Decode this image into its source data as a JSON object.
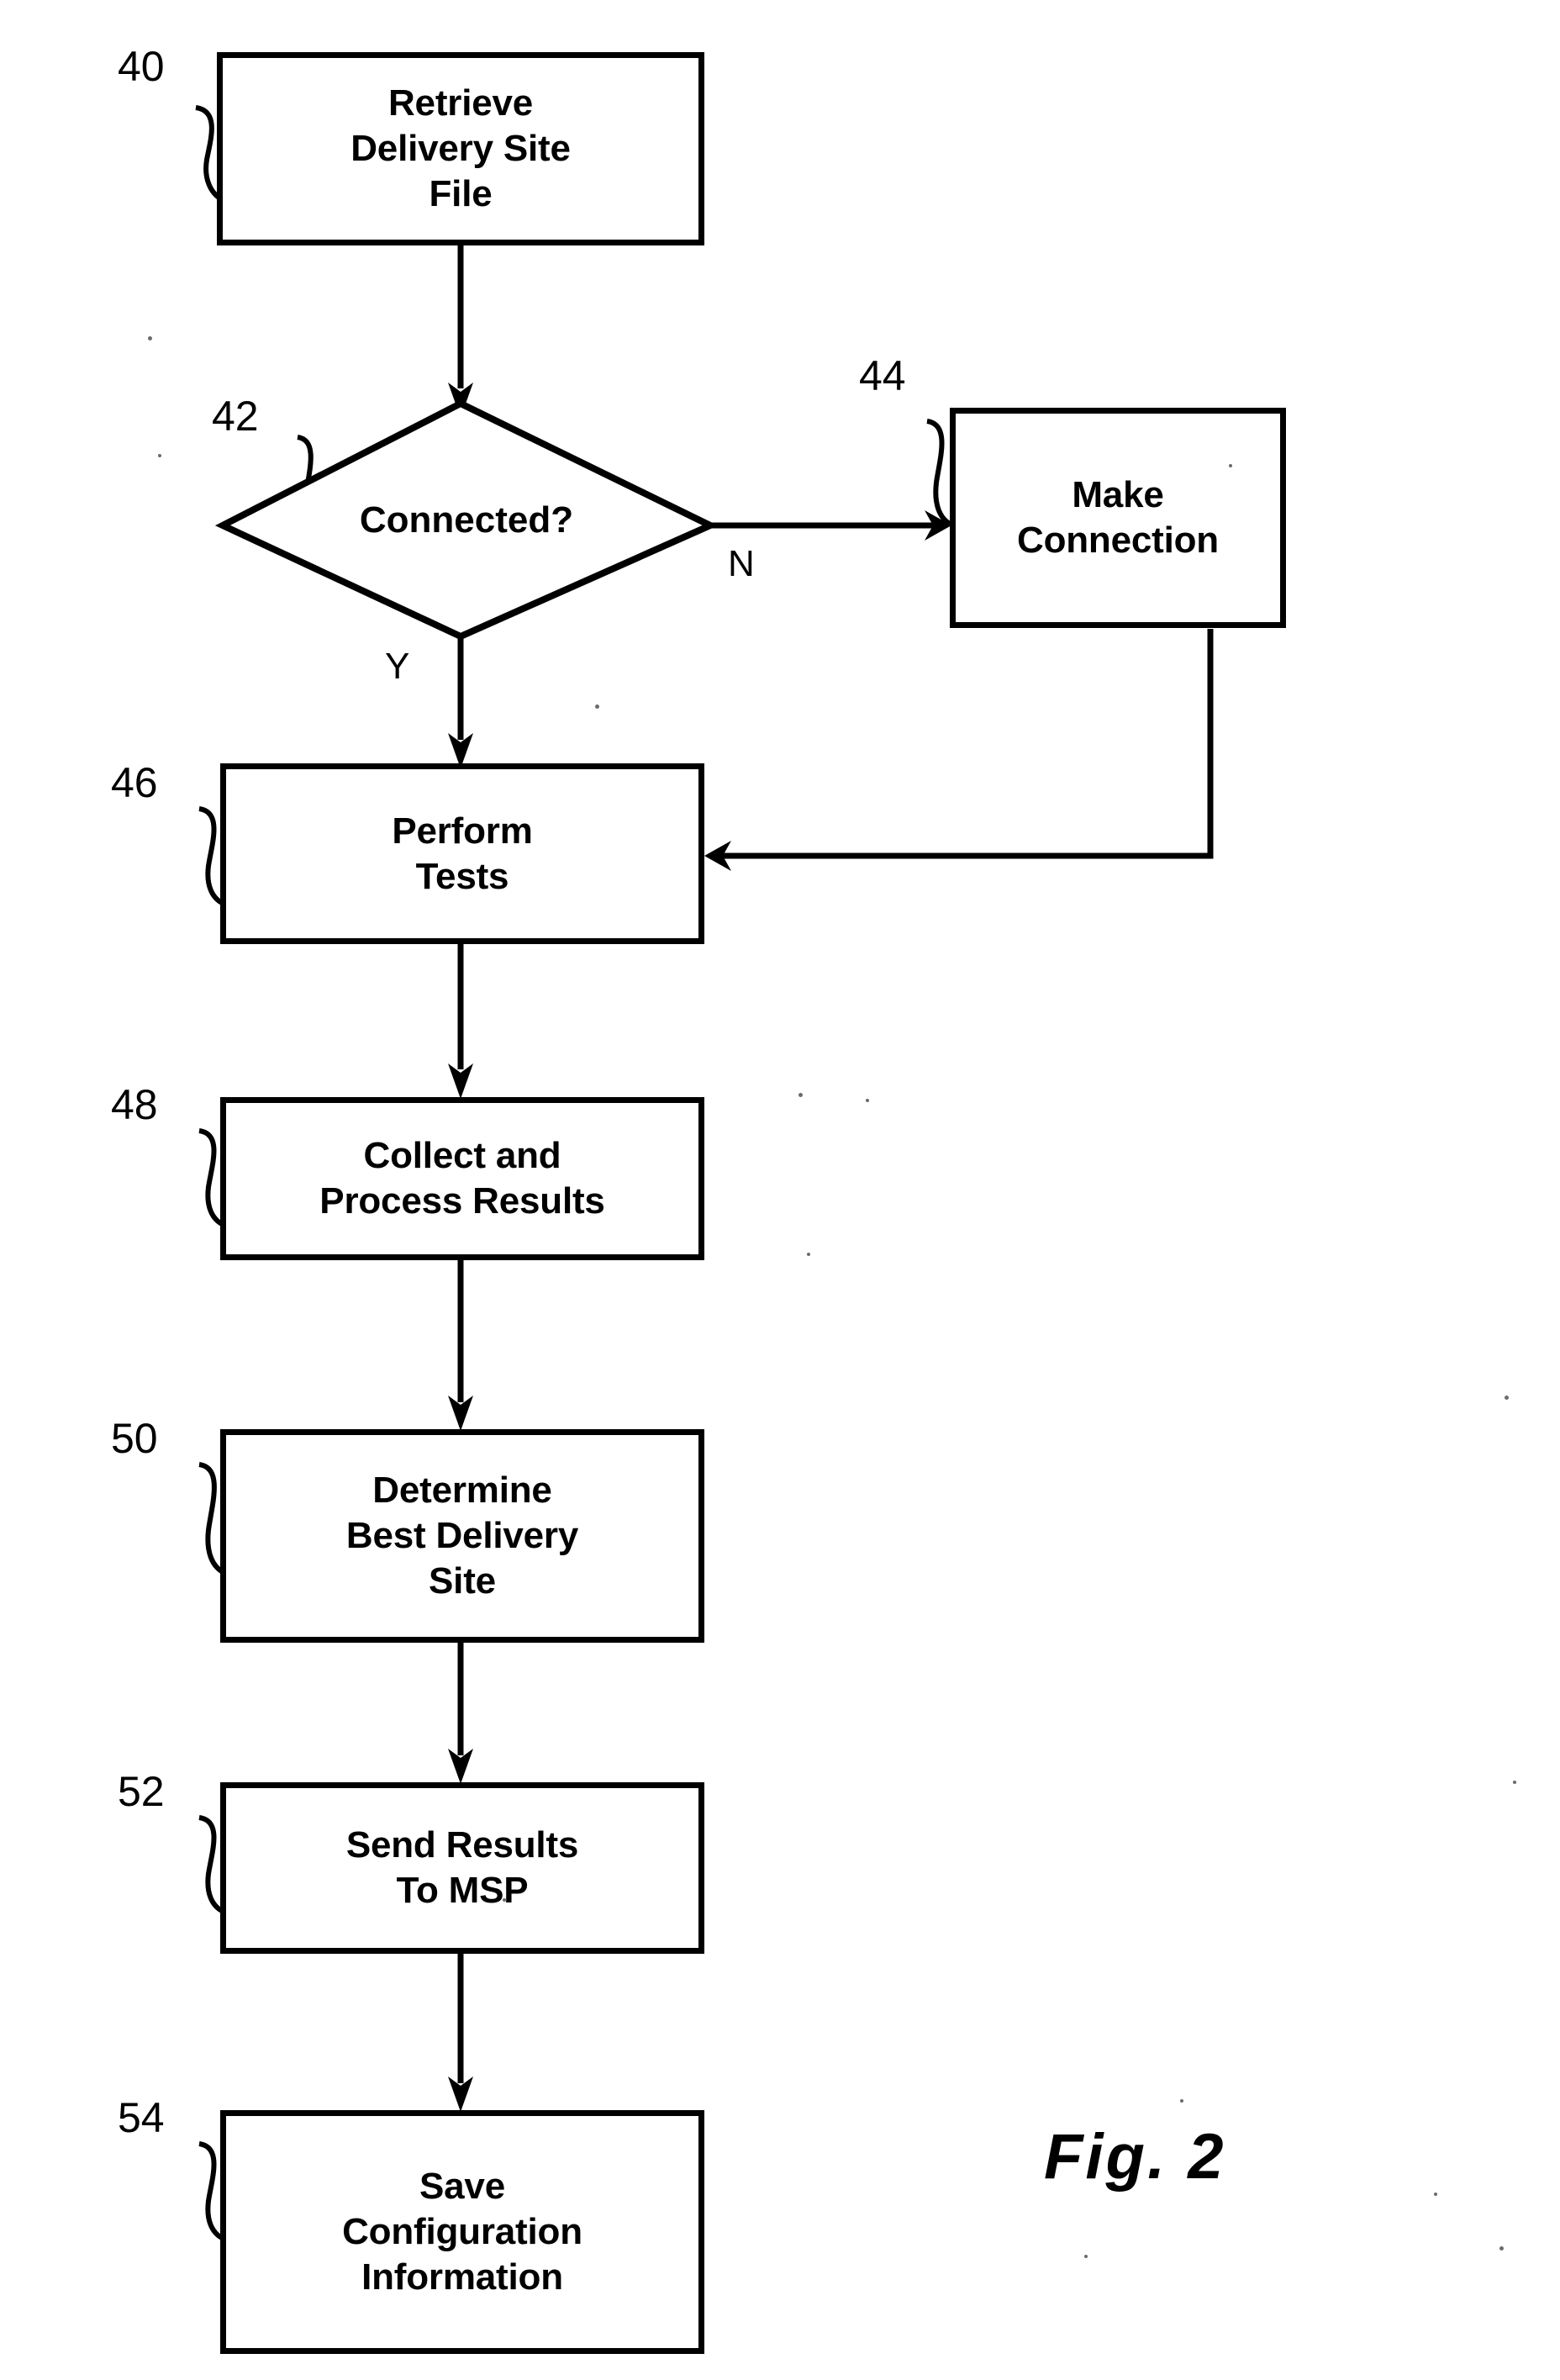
{
  "figure": {
    "caption": "Fig. 2",
    "background_color": "#ffffff",
    "ink_color": "#000000"
  },
  "nodes": [
    {
      "id": "n40",
      "ref": "40",
      "shape": "process",
      "label": "Retrieve\nDelivery Site\nFile"
    },
    {
      "id": "n42",
      "ref": "42",
      "shape": "decision",
      "label": "Connected?"
    },
    {
      "id": "n44",
      "ref": "44",
      "shape": "process",
      "label": "Make\nConnection"
    },
    {
      "id": "n46",
      "ref": "46",
      "shape": "process",
      "label": "Perform\nTests"
    },
    {
      "id": "n48",
      "ref": "48",
      "shape": "process",
      "label": "Collect and\nProcess Results"
    },
    {
      "id": "n50",
      "ref": "50",
      "shape": "process",
      "label": "Determine\nBest Delivery\nSite"
    },
    {
      "id": "n52",
      "ref": "52",
      "shape": "process",
      "label": "Send Results\nTo MSP"
    },
    {
      "id": "n54",
      "ref": "54",
      "shape": "process",
      "label": "Save\nConfiguration\nInformation"
    }
  ],
  "branch_labels": {
    "no": "N",
    "yes": "Y"
  },
  "edges": [
    {
      "from": "n40",
      "to": "n42",
      "label": ""
    },
    {
      "from": "n42",
      "to": "n44",
      "label": "N"
    },
    {
      "from": "n42",
      "to": "n46",
      "label": "Y"
    },
    {
      "from": "n44",
      "to": "n46",
      "label": ""
    },
    {
      "from": "n46",
      "to": "n48",
      "label": ""
    },
    {
      "from": "n48",
      "to": "n50",
      "label": ""
    },
    {
      "from": "n50",
      "to": "n52",
      "label": ""
    },
    {
      "from": "n52",
      "to": "n54",
      "label": ""
    }
  ]
}
